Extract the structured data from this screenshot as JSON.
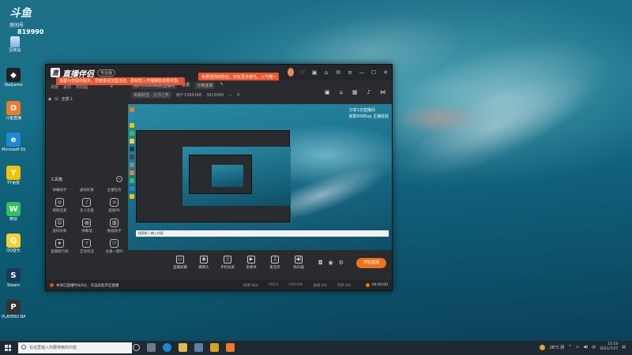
{
  "desktop": {
    "logo_text": "斗鱼",
    "room_label": "房间号",
    "room_number": "819990",
    "recycle_label": "回收站",
    "icons": [
      {
        "label": "SteGame",
        "color": "#222",
        "glyph": "◆"
      },
      {
        "label": "斗鱼直播",
        "color": "#f07a28",
        "glyph": "D"
      },
      {
        "label": "Microsoft Edge",
        "color": "#1a8ad4",
        "glyph": "e"
      },
      {
        "label": "YY语音",
        "color": "#f4c200",
        "glyph": "Y"
      },
      {
        "label": "微信",
        "color": "#35c05b",
        "glyph": "W"
      },
      {
        "label": "QQ音乐",
        "color": "#f5d130",
        "glyph": "Q"
      },
      {
        "label": "Steam",
        "color": "#1b3a5a",
        "glyph": "S"
      },
      {
        "label": "PLAYERU BATTLEGR...",
        "color": "#333",
        "glyph": "P"
      }
    ]
  },
  "app": {
    "brand": "直播伴侣",
    "version_badge": "专业版",
    "promo_text": "免费送你的粉丝，好友更多曝光，入气哦~",
    "notice_text": "温馨为您提供服务，您被邀请加盟活动，那就帮入开播赚取流量奖励。",
    "tabs": [
      "场景",
      "素材",
      "布局图"
    ],
    "scene_label": "全部 1",
    "room_title": "用户1586348的直播间",
    "room_edit": "重置",
    "room_tag": "分类选择",
    "info_category": "英雄联盟 · 云顶之弈",
    "info_user": "用户1586348",
    "info_room": "3819990",
    "info_count": "0",
    "tools_title": "工具箱",
    "tools_toggle": "−",
    "tools": [
      {
        "label": "弹幕助手",
        "icon": "",
        "text_only": true
      },
      {
        "label": "虚拟形象",
        "icon": "",
        "text_only": true
      },
      {
        "label": "主播任务",
        "icon": "",
        "text_only": true
      },
      {
        "label": "视频连麦",
        "icon": "◎",
        "text_only": false
      },
      {
        "label": "多人连麦",
        "icon": "♪",
        "text_only": false
      },
      {
        "label": "超级PK",
        "icon": "⚔",
        "text_only": false
      },
      {
        "label": "虚拟形象",
        "icon": "☺",
        "text_only": false
      },
      {
        "label": "弹幕墙",
        "icon": "▤",
        "text_only": false
      },
      {
        "label": "数据助手",
        "icon": "▥",
        "text_only": false
      },
      {
        "label": "直播排行榜",
        "icon": "★",
        "text_only": false
      },
      {
        "label": "互动玩法",
        "icon": "⚡",
        "text_only": false
      },
      {
        "label": "主播一键约",
        "icon": "⚇",
        "text_only": false
      }
    ],
    "live_info_line1": "分享1次直播间",
    "live_info_line2": "获取500Exp 主播经验",
    "bottom_tools": [
      {
        "label": "直播屏幕",
        "icon": "▭"
      },
      {
        "label": "摄像头",
        "icon": "◉"
      },
      {
        "label": "手机投屏",
        "icon": "▯"
      },
      {
        "label": "多媒体",
        "icon": "▶"
      },
      {
        "label": "麦克风",
        "icon": "♫"
      },
      {
        "label": "扬声器",
        "icon": "◀)"
      }
    ],
    "start_live_label": "开始直播",
    "status_warning": "本场已直播时长0分，点击此处开启直播",
    "status_stats": [
      "码率:0kb",
      "FPS:0",
      "CPU:0%",
      "丢帧:0%",
      "内存:0%"
    ],
    "status_timer": "00:00:00",
    "inner_search_text": "搜索框 / 输入内容"
  },
  "taskbar": {
    "search_placeholder": "在这里输入你要搜索的内容",
    "weather": "28°C 阴",
    "ime": "中",
    "time": "15:14",
    "date": "2021/7/27"
  }
}
